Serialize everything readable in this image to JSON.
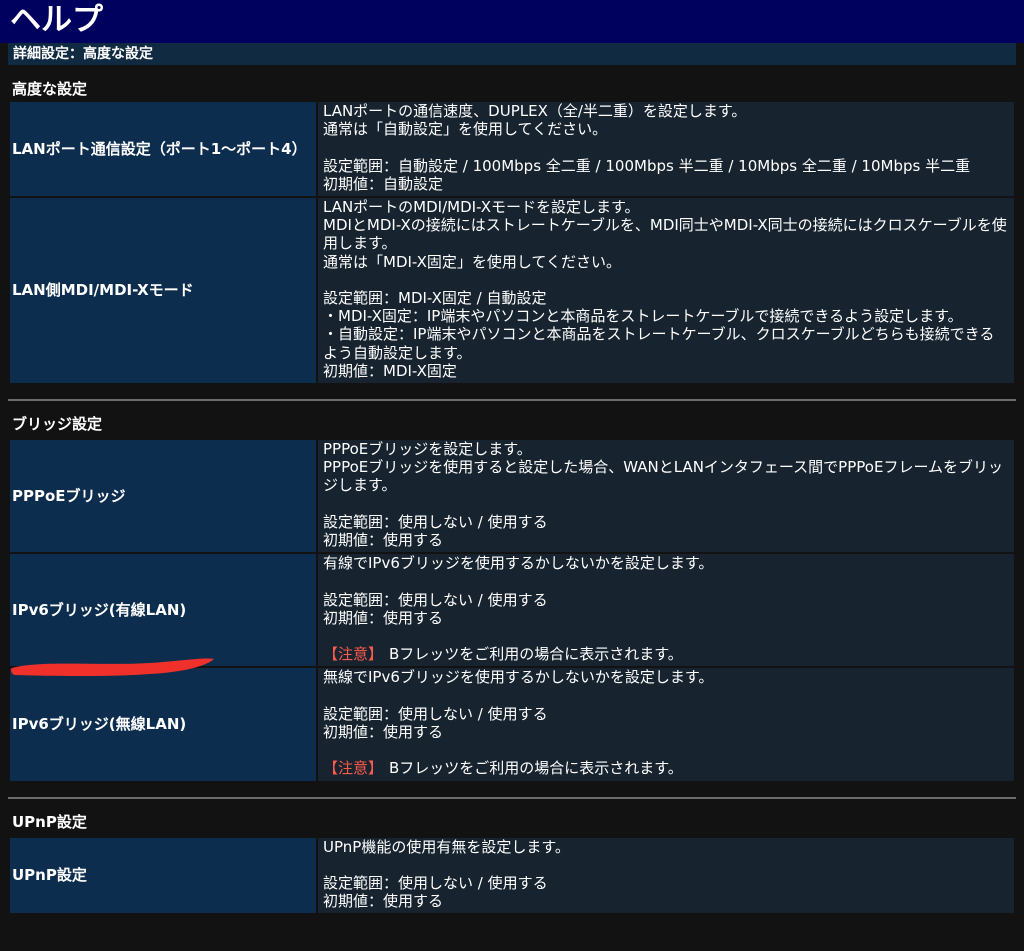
{
  "header": {
    "title": "ヘルプ"
  },
  "breadcrumb": "詳細設定：高度な設定",
  "sections": [
    {
      "title": "高度な設定",
      "rows": [
        {
          "label": "LANポート通信設定（ポート1〜ポート4）",
          "lines": [
            "LANポートの通信速度、DUPLEX（全/半二重）を設定します。",
            "通常は「自動設定」を使用してください。",
            "",
            "設定範囲：自動設定 / 100Mbps 全二重 / 100Mbps 半二重 / 10Mbps 全二重 / 10Mbps 半二重",
            "初期値：自動設定"
          ]
        },
        {
          "label": "LAN側MDI/MDI-Xモード",
          "lines": [
            "LANポートのMDI/MDI-Xモードを設定します。",
            "MDIとMDI-Xの接続にはストレートケーブルを、MDI同士やMDI-X同士の接続にはクロスケーブルを使用します。",
            "通常は「MDI-X固定」を使用してください。",
            "",
            "設定範囲：MDI-X固定 / 自動設定",
            "・MDI-X固定：IP端末やパソコンと本商品をストレートケーブルで接続できるよう設定します。",
            "・自動設定：IP端末やパソコンと本商品をストレートケーブル、クロスケーブルどちらも接続できるよう自動設定します。",
            "初期値：MDI-X固定"
          ]
        }
      ]
    },
    {
      "title": "ブリッジ設定",
      "rows": [
        {
          "label": "PPPoEブリッジ",
          "lines": [
            "PPPoEブリッジを設定します。",
            "PPPoEブリッジを使用すると設定した場合、WANとLANインタフェース間でPPPoEフレームをブリッジします。",
            "",
            "設定範囲：使用しない / 使用する",
            "初期値：使用する"
          ]
        },
        {
          "label": "IPv6ブリッジ(有線LAN)",
          "lines": [
            "有線でIPv6ブリッジを使用するかしないかを設定します。",
            "",
            "設定範囲：使用しない / 使用する",
            "初期値：使用する",
            ""
          ],
          "note_label": "【注意】",
          "note_text": "Bフレッツをご利用の場合に表示されます。"
        },
        {
          "label": "IPv6ブリッジ(無線LAN)",
          "lines": [
            "無線でIPv6ブリッジを使用するかしないかを設定します。",
            "",
            "設定範囲：使用しない / 使用する",
            "初期値：使用する",
            ""
          ],
          "note_label": "【注意】",
          "note_text": "Bフレッツをご利用の場合に表示されます。"
        }
      ]
    },
    {
      "title": "UPnP設定",
      "rows": [
        {
          "label": "UPnP設定",
          "lines": [
            "UPnP機能の使用有無を設定します。",
            "",
            "設定範囲：使用しない / 使用する",
            "初期値：使用する"
          ]
        }
      ]
    }
  ],
  "colors": {
    "header_bg": "#00005f",
    "label_bg": "#0d2d4e",
    "desc_bg": "#172430",
    "note": "#ff5a4a",
    "redaction_mark": "#f0302a"
  }
}
